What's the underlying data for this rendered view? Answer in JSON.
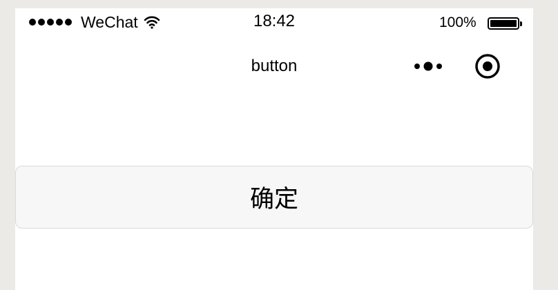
{
  "status_bar": {
    "carrier": "WeChat",
    "time": "18:42",
    "battery_percent": "100%",
    "signal_strength_dots": 5,
    "icons": [
      "signal-icon",
      "wifi-icon",
      "battery-icon"
    ]
  },
  "nav_bar": {
    "title": "button",
    "icons": [
      "more-icon",
      "close-icon"
    ]
  },
  "main": {
    "button_label": "确定"
  }
}
